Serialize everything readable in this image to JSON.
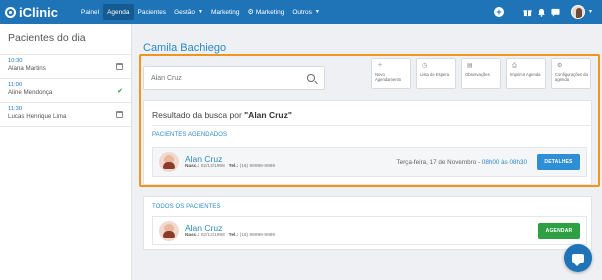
{
  "app": {
    "logo_text": "iClinic"
  },
  "nav": {
    "items": [
      {
        "label": "Painel",
        "active": false
      },
      {
        "label": "Agenda",
        "active": true
      },
      {
        "label": "Pacientes",
        "active": false
      },
      {
        "label": "Gestão",
        "active": false,
        "dropdown": true
      },
      {
        "label": "Marketing",
        "active": false
      },
      {
        "label": "Marketing",
        "active": false,
        "icon": "gear-icon"
      },
      {
        "label": "Outros",
        "active": false,
        "dropdown": true
      }
    ],
    "right_icons": [
      "plus-icon",
      "gift-icon",
      "bell-icon",
      "chat-icon",
      "avatar"
    ]
  },
  "sidebar": {
    "title": "Pacientes do dia",
    "patients": [
      {
        "time": "10:30",
        "name": "Alana Martins",
        "status_icon": "calendar-icon"
      },
      {
        "time": "11:00",
        "name": "Aline Mendonça",
        "status_icon": "check-icon"
      },
      {
        "time": "11:30",
        "name": "Lucas Henrique Lima",
        "status_icon": "calendar-icon"
      }
    ]
  },
  "main": {
    "title": "Camila Bachiego",
    "search": {
      "value": "Alan Cruz"
    },
    "actions": [
      {
        "icon": "plus-icon",
        "label": "Novo Agendamento"
      },
      {
        "icon": "clock-icon",
        "label": "Lista de Espera"
      },
      {
        "icon": "notes-icon",
        "label": "Observações"
      },
      {
        "icon": "print-icon",
        "label": "Imprimir Agenda"
      },
      {
        "icon": "gear-icon",
        "label": "Configurações da agenda"
      }
    ],
    "results": {
      "prefix": "Resultado da busca por ",
      "query": "\"Alan Cruz\"",
      "section_label": "PACIENTES AGENDADOS",
      "patient": {
        "name": "Alan Cruz",
        "birth_label": "Nasc.:",
        "birth": "02/12/1998",
        "phone_label": "Tel.:",
        "phone": "(16) 99999-9999",
        "appointment_date": "Terça-feira, 17 de Novembro - ",
        "appointment_time": "08h00 às 08h30",
        "button": "DETALHES"
      }
    },
    "all_patients": {
      "section_label": "TODOS OS PACIENTES",
      "patient": {
        "name": "Alan Cruz",
        "birth_label": "Nasc.:",
        "birth": "02/12/1998",
        "phone_label": "Tel.:",
        "phone": "(16) 99999-9999",
        "button": "AGENDAR"
      }
    }
  },
  "colors": {
    "nav": "#1f73b7",
    "accent": "#2a8ac5",
    "highlight": "#f0961f",
    "success": "#2ea043"
  }
}
